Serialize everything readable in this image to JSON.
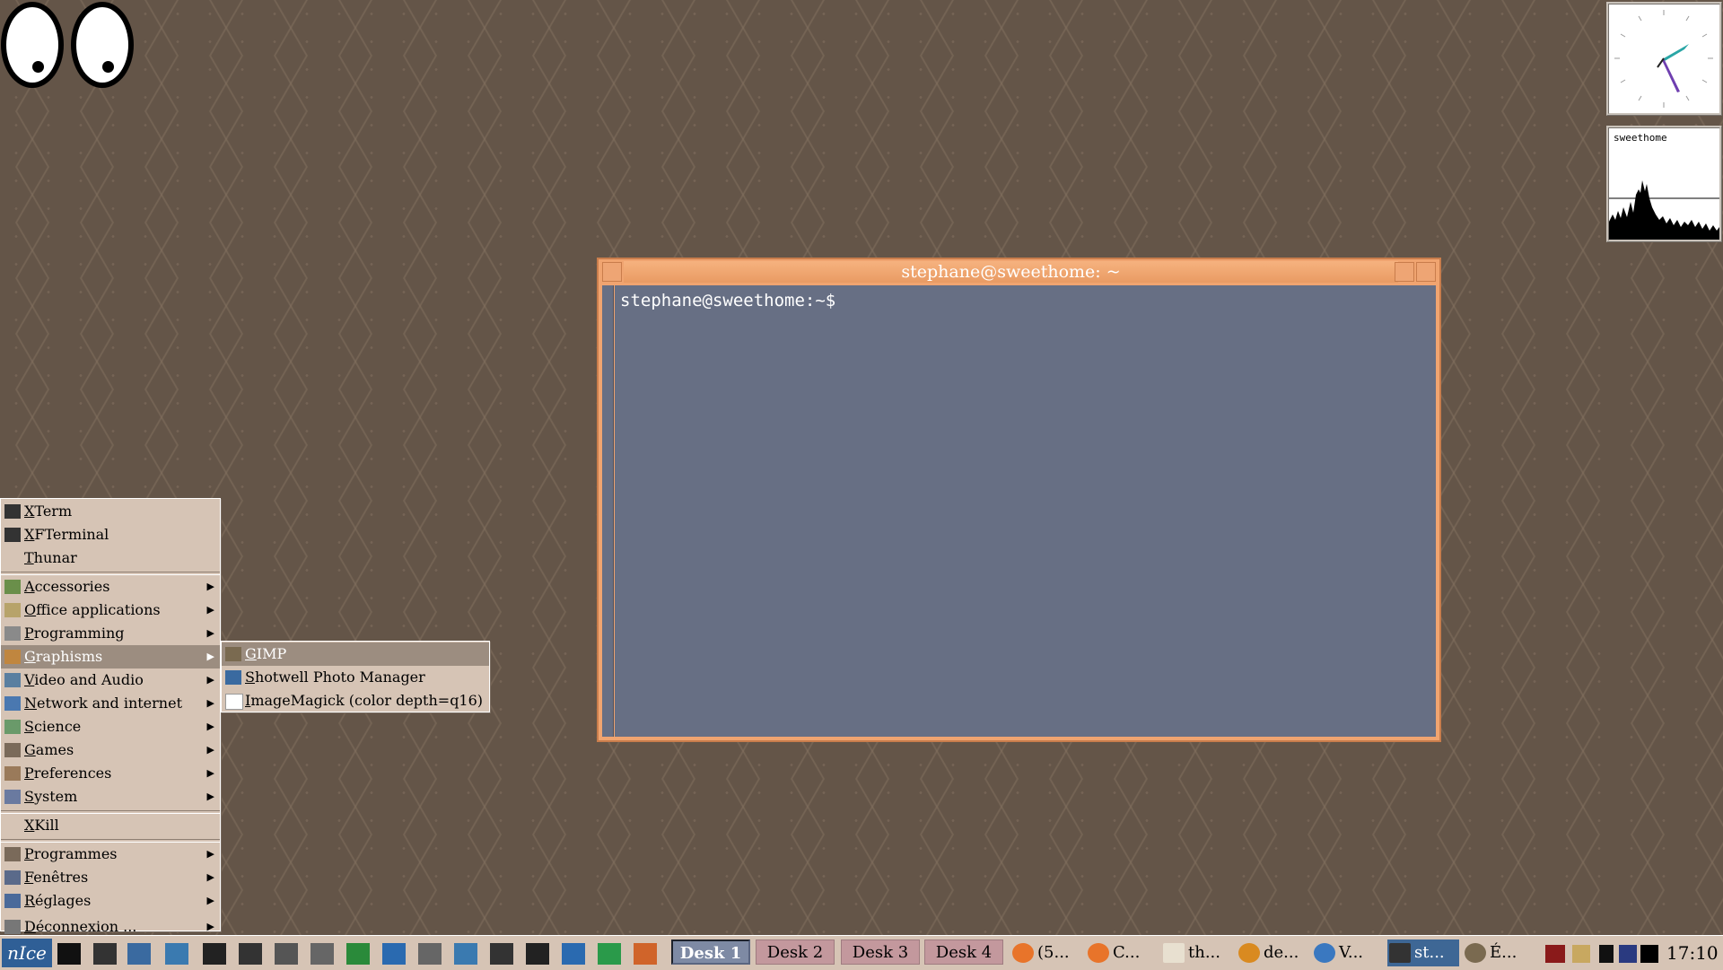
{
  "terminal": {
    "title": "stephane@sweethome: ~",
    "prompt": "stephane@sweethome:~$"
  },
  "load_widget": {
    "label": "sweethome"
  },
  "start_menu": {
    "top_items": [
      {
        "label": "XTerm",
        "icon": "terminal-icon"
      },
      {
        "label": "XFTerminal",
        "icon": "terminal-icon"
      },
      {
        "label": "Thunar",
        "icon": ""
      }
    ],
    "categories": [
      {
        "label": "Accessories",
        "icon": "accessories-icon"
      },
      {
        "label": "Office applications",
        "icon": "office-icon"
      },
      {
        "label": "Programming",
        "icon": "programming-icon"
      },
      {
        "label": "Graphisms",
        "icon": "graphics-icon"
      },
      {
        "label": "Video and Audio",
        "icon": "video-audio-icon"
      },
      {
        "label": "Network and internet",
        "icon": "network-icon"
      },
      {
        "label": "Science",
        "icon": "science-icon"
      },
      {
        "label": "Games",
        "icon": "games-icon"
      },
      {
        "label": "Preferences",
        "icon": "preferences-icon"
      },
      {
        "label": "System",
        "icon": "system-icon"
      }
    ],
    "xkill": "XKill",
    "bottom_items": [
      {
        "label": "Programmes",
        "icon": "programs-icon"
      },
      {
        "label": "Fenêtres",
        "icon": "windows-icon"
      },
      {
        "label": "Réglages",
        "icon": "settings-icon"
      },
      {
        "label": "Déconnexion ...",
        "icon": "logout-icon"
      }
    ]
  },
  "graphics_submenu": [
    {
      "label": "GIMP",
      "icon": "gimp-icon"
    },
    {
      "label": "Shotwell Photo Manager",
      "icon": "shotwell-icon"
    },
    {
      "label": "ImageMagick (color depth=q16)",
      "icon": "imagemagick-icon"
    }
  ],
  "taskbar": {
    "start_label": "nIce",
    "desks": [
      "Desk 1",
      "Desk 2",
      "Desk 3",
      "Desk 4"
    ],
    "tasks": [
      {
        "label": "(5...",
        "icon": "firefox-icon"
      },
      {
        "label": "C...",
        "icon": "firefox-icon"
      },
      {
        "label": "th...",
        "icon": "folder-icon"
      },
      {
        "label": "de...",
        "icon": "app-icon"
      },
      {
        "label": "V...",
        "icon": "thunderbird-icon"
      },
      {
        "label": "st...",
        "icon": "terminal-icon"
      },
      {
        "label": "É...",
        "icon": "gimp-icon"
      }
    ],
    "clock": "17:10"
  },
  "colors": {
    "desktop": "#645548",
    "menu_bg": "#d6c4b5",
    "menu_highlight": "#9c8d80",
    "window_frame": "#f0a470",
    "terminal_bg": "#676f84",
    "active_desk": "#7e8aa4",
    "inactive_desk": "#c3989d"
  }
}
